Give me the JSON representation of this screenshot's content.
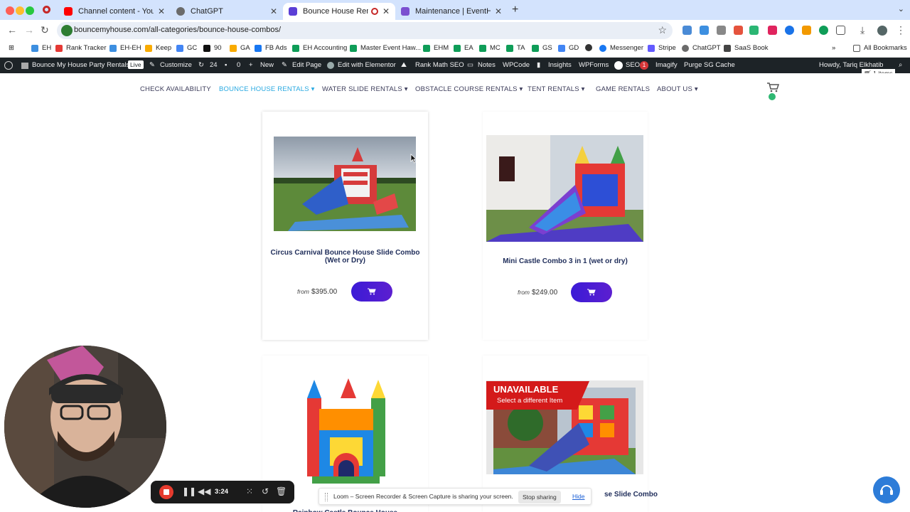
{
  "browser": {
    "tabs": [
      {
        "title": "Channel content - YouTube Studio",
        "active": false,
        "color": "#ff0000"
      },
      {
        "title": "ChatGPT",
        "active": false,
        "color": "#6b6b6b"
      },
      {
        "title": "Bounce House Rentals - Bounce",
        "active": true,
        "color": "#5b3fd6"
      },
      {
        "title": "Maintenance | EventHawk",
        "active": false,
        "color": "#7b4fd0"
      }
    ],
    "url": "bouncemyhouse.com/all-categories/bounce-house-combos/",
    "bookmarks": [
      "EH",
      "Rank Tracker",
      "EH-EH",
      "Keep",
      "GC",
      "90",
      "GA",
      "FB Ads",
      "EH Accounting",
      "Master Event Haw...",
      "EHM",
      "EA",
      "MC",
      "TA",
      "GS",
      "GD",
      "",
      "Messenger",
      "Stripe",
      "ChatGPT",
      "SaaS Book",
      "All Bookmarks"
    ]
  },
  "wpbar": {
    "site": "Bounce My House Party Rentals",
    "live": "Live",
    "customize": "Customize",
    "updates": "24",
    "comments": "0",
    "new": "New",
    "edit_page": "Edit Page",
    "elementor": "Edit with Elementor",
    "rankmath": "Rank Math SEO",
    "notes": "Notes",
    "wpcode": "WPCode",
    "insights": "Insights",
    "wpforms": "WPForms",
    "seo": "SEO",
    "seo_badge": "1",
    "imagify": "Imagify",
    "purge": "Purge SG Cache",
    "howdy": "Howdy, Tariq Elkhatib"
  },
  "cart": {
    "count_label": "1 items"
  },
  "nav": {
    "items": [
      "CHECK AVAILABILITY",
      "BOUNCE HOUSE RENTALS",
      "WATER SLIDE RENTALS",
      "OBSTACLE COURSE RENTALS",
      "TENT RENTALS",
      "GAME RENTALS",
      "ABOUT US"
    ],
    "active_color": "#29a9e1"
  },
  "products": [
    {
      "name": "Circus Carnival Bounce House Slide Combo (Wet or Dry)",
      "from": "from",
      "price": "$395.00"
    },
    {
      "name": "Mini Castle Combo 3 in 1 (wet or dry)",
      "from": "from",
      "price": "$249.00"
    },
    {
      "name": "Rainbow Castle Bounce House",
      "visible_text": "Rainbow Castle Bounce House"
    },
    {
      "name_partial": "se Slide Combo",
      "unavailable": "UNAVAILABLE",
      "unavailable_sub": "Select a different Item"
    }
  ],
  "recorder": {
    "time": "3:24"
  },
  "loom": {
    "message": "Loom – Screen Recorder & Screen Capture is sharing your screen.",
    "stop": "Stop sharing",
    "hide": "Hide"
  }
}
